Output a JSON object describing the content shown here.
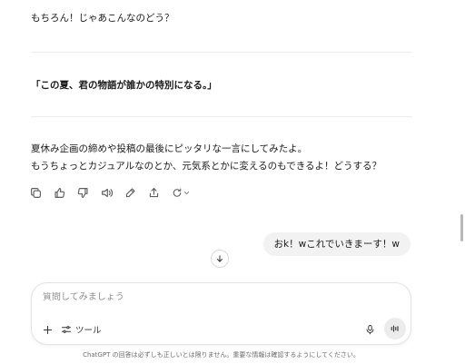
{
  "conversation": {
    "assistant_intro": "もちろん！じゃあこんなのどう？",
    "highlight_phrase": "「この夏、君の物語が誰かの特別になる。」",
    "assistant_body_line1": "夏休み企画の締めや投稿の最後にピッタリな一言にしてみたよ。",
    "assistant_body_line2": "もうちょっとカジュアルなのとか、元気系とかに変えるのもできるよ！どうする？",
    "user_message": "おk！wこれでいきまーす！w"
  },
  "message_actions": [
    "copy-icon",
    "thumbs-up-icon",
    "thumbs-down-icon",
    "speaker-icon",
    "edit-icon",
    "share-icon",
    "regenerate-icon"
  ],
  "composer": {
    "placeholder": "質問してみましょう",
    "tools_label": "ツール"
  },
  "footer": {
    "disclaimer": "ChatGPT の回答は必ずしも正しいとは限りません。重要な情報は確認するようにしてください。"
  }
}
